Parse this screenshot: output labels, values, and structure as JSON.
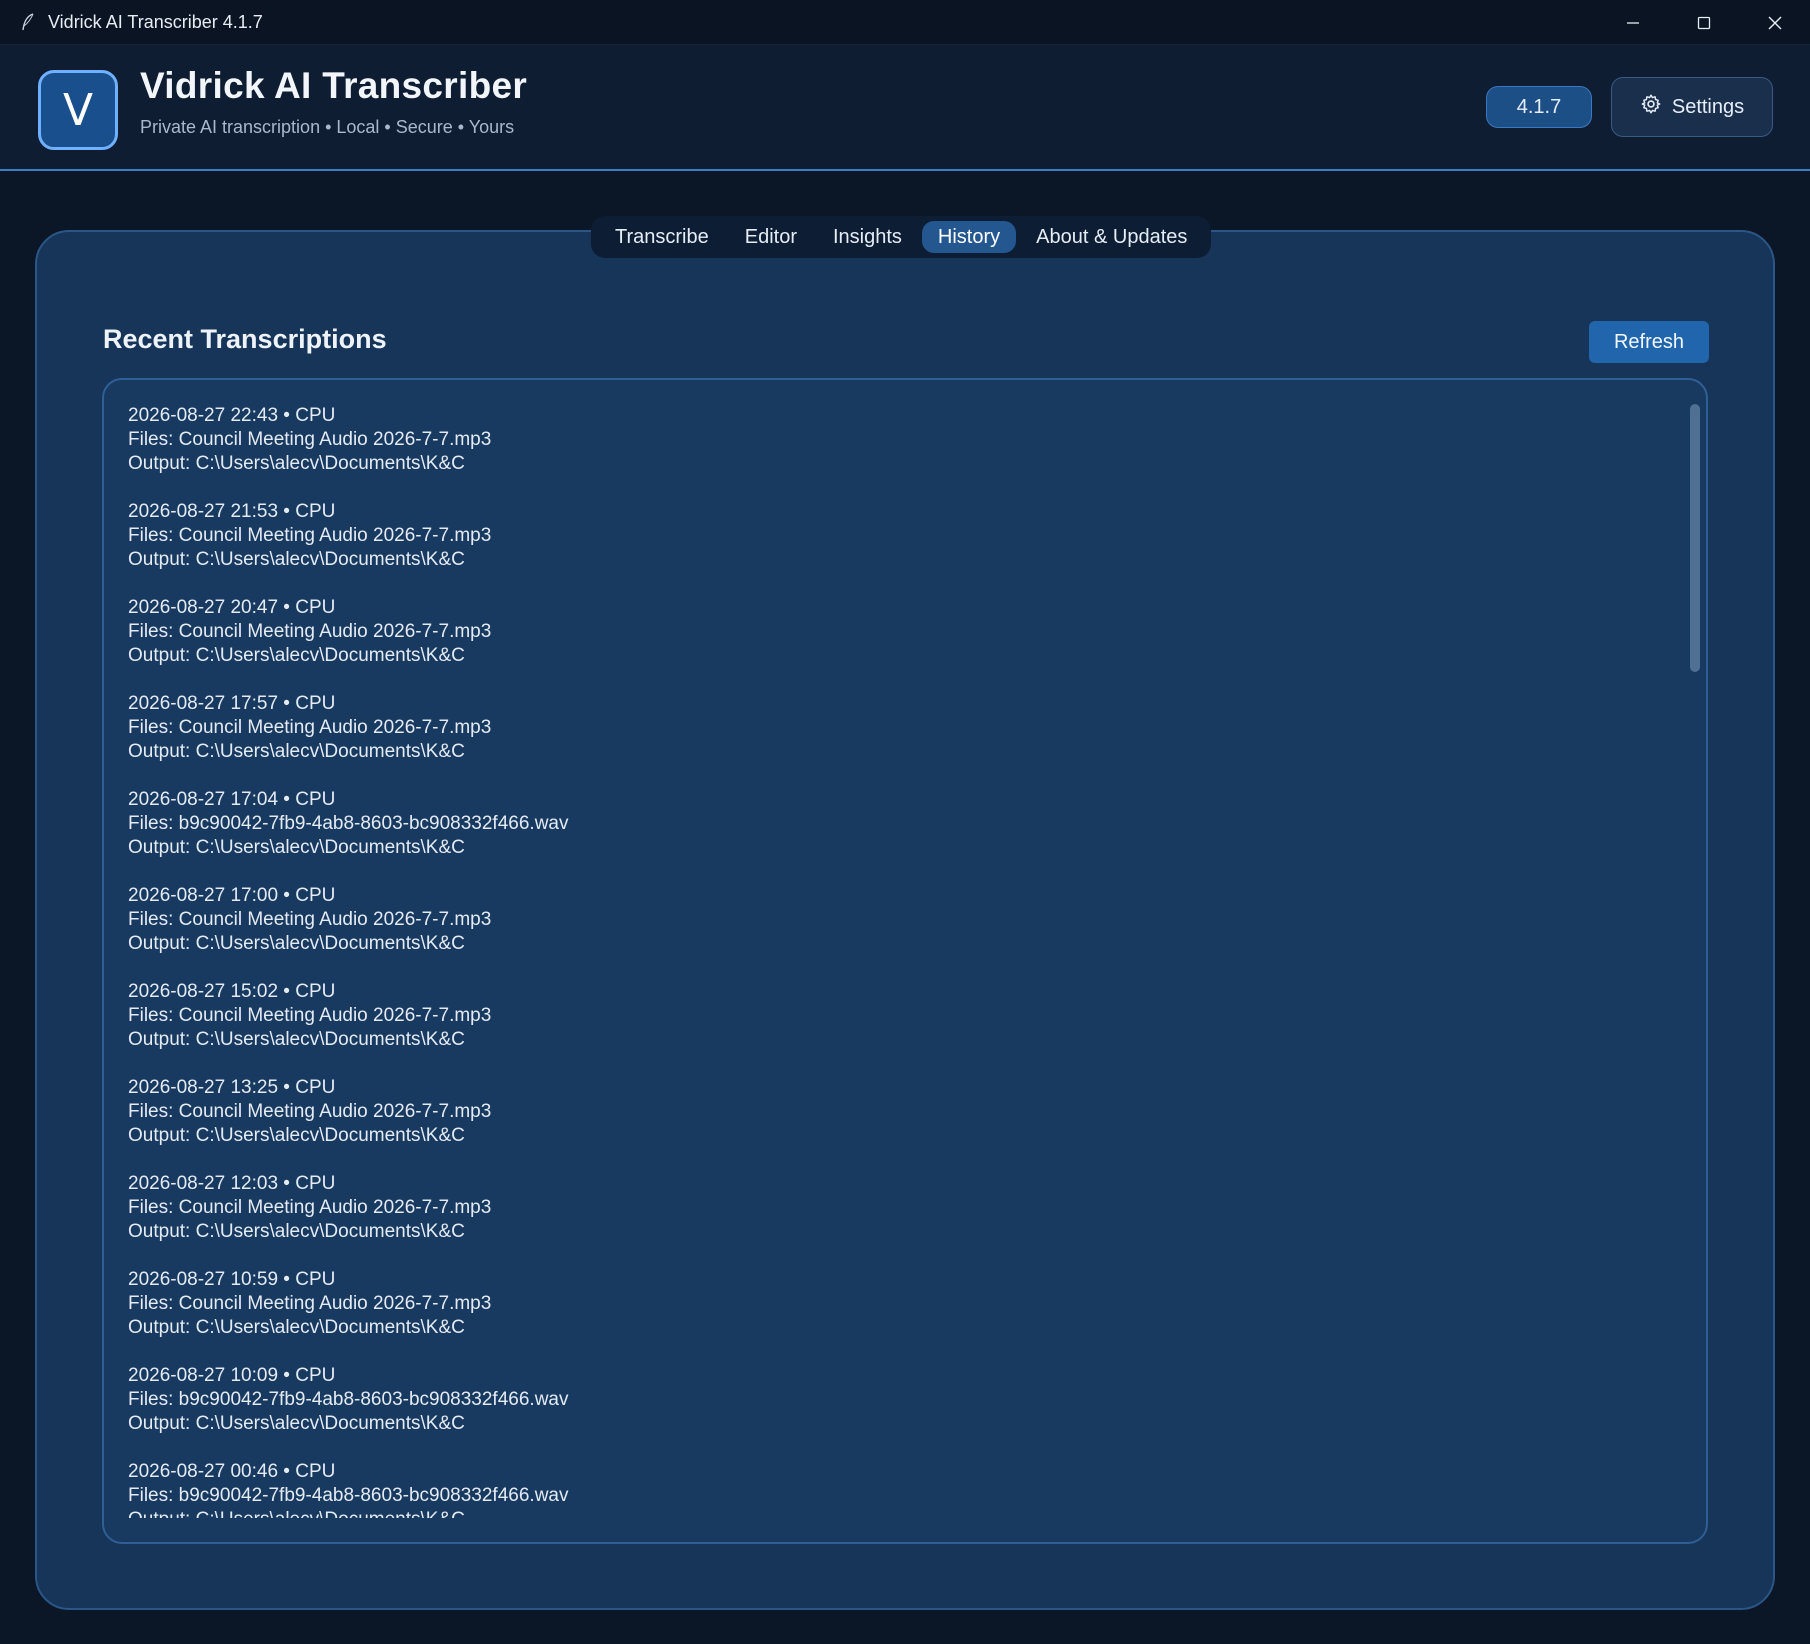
{
  "window": {
    "title": "Vidrick AI Transcriber 4.1.7"
  },
  "header": {
    "logo_letter": "V",
    "title": "Vidrick AI Transcriber",
    "subtitle": "Private AI transcription • Local • Secure • Yours",
    "version": "4.1.7",
    "settings_label": "Settings"
  },
  "tabs": [
    {
      "label": "Transcribe",
      "active": false
    },
    {
      "label": "Editor",
      "active": false
    },
    {
      "label": "Insights",
      "active": false
    },
    {
      "label": "History",
      "active": true
    },
    {
      "label": "About & Updates",
      "active": false
    }
  ],
  "history": {
    "title": "Recent Transcriptions",
    "refresh_label": "Refresh",
    "entries": [
      {
        "header": "2026-08-27 22:43 • CPU",
        "files": "Files: Council Meeting Audio 2026-7-7.mp3",
        "output": "Output: C:\\Users\\alecv\\Documents\\K&C"
      },
      {
        "header": "2026-08-27 21:53 • CPU",
        "files": "Files: Council Meeting Audio 2026-7-7.mp3",
        "output": "Output: C:\\Users\\alecv\\Documents\\K&C"
      },
      {
        "header": "2026-08-27 20:47 • CPU",
        "files": "Files: Council Meeting Audio 2026-7-7.mp3",
        "output": "Output: C:\\Users\\alecv\\Documents\\K&C"
      },
      {
        "header": "2026-08-27 17:57 • CPU",
        "files": "Files: Council Meeting Audio 2026-7-7.mp3",
        "output": "Output: C:\\Users\\alecv\\Documents\\K&C"
      },
      {
        "header": "2026-08-27 17:04 • CPU",
        "files": "Files: b9c90042-7fb9-4ab8-8603-bc908332f466.wav",
        "output": "Output: C:\\Users\\alecv\\Documents\\K&C"
      },
      {
        "header": "2026-08-27 17:00 • CPU",
        "files": "Files: Council Meeting Audio 2026-7-7.mp3",
        "output": "Output: C:\\Users\\alecv\\Documents\\K&C"
      },
      {
        "header": "2026-08-27 15:02 • CPU",
        "files": "Files: Council Meeting Audio 2026-7-7.mp3",
        "output": "Output: C:\\Users\\alecv\\Documents\\K&C"
      },
      {
        "header": "2026-08-27 13:25 • CPU",
        "files": "Files: Council Meeting Audio 2026-7-7.mp3",
        "output": "Output: C:\\Users\\alecv\\Documents\\K&C"
      },
      {
        "header": "2026-08-27 12:03 • CPU",
        "files": "Files: Council Meeting Audio 2026-7-7.mp3",
        "output": "Output: C:\\Users\\alecv\\Documents\\K&C"
      },
      {
        "header": "2026-08-27 10:59 • CPU",
        "files": "Files: Council Meeting Audio 2026-7-7.mp3",
        "output": "Output: C:\\Users\\alecv\\Documents\\K&C"
      },
      {
        "header": "2026-08-27 10:09 • CPU",
        "files": "Files: b9c90042-7fb9-4ab8-8603-bc908332f466.wav",
        "output": "Output: C:\\Users\\alecv\\Documents\\K&C"
      },
      {
        "header": "2026-08-27 00:46 • CPU",
        "files": "Files: b9c90042-7fb9-4ab8-8603-bc908332f466.wav",
        "output": "Output: C:\\Users\\alecv\\Documents\\K&C"
      }
    ]
  },
  "colors": {
    "accent": "#2165ad",
    "panel": "#163558",
    "background": "#0b1626"
  },
  "icons": {
    "app": "feather-icon",
    "settings": "gear-icon",
    "minimize": "minimize-icon",
    "maximize": "maximize-icon",
    "close": "close-icon"
  }
}
